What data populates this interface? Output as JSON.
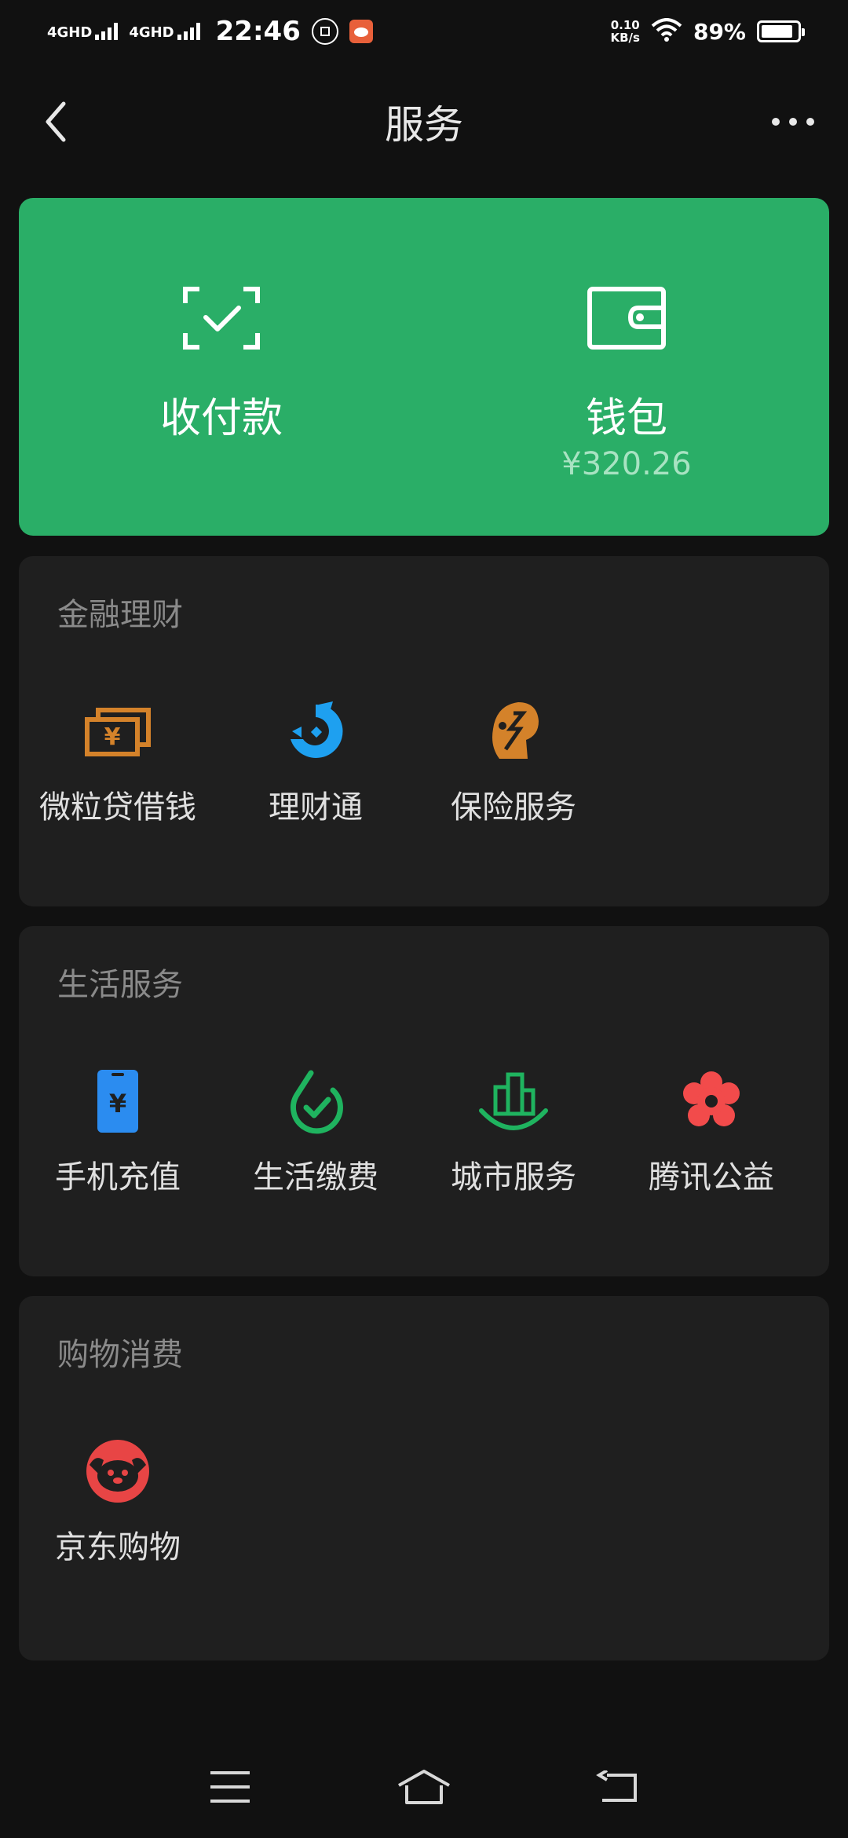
{
  "status_bar": {
    "net1": "4GHD",
    "net2": "4GHD",
    "time": "22:46",
    "speed_value": "0.10",
    "speed_unit": "KB/s",
    "battery": "89%",
    "battery_level": 0.89
  },
  "header": {
    "title": "服务"
  },
  "wallet_card": {
    "pay_label": "收付款",
    "wallet_label": "钱包",
    "wallet_balance": "¥320.26"
  },
  "sections": {
    "finance": {
      "title": "金融理财",
      "items": [
        {
          "label": "微粒贷借钱",
          "icon": "weilidai-icon"
        },
        {
          "label": "理财通",
          "icon": "licaitong-icon"
        },
        {
          "label": "保险服务",
          "icon": "insurance-icon"
        }
      ]
    },
    "life": {
      "title": "生活服务",
      "items": [
        {
          "label": "手机充值",
          "icon": "phone-topup-icon"
        },
        {
          "label": "生活缴费",
          "icon": "utility-payment-icon"
        },
        {
          "label": "城市服务",
          "icon": "city-services-icon"
        },
        {
          "label": "腾讯公益",
          "icon": "tencent-charity-icon"
        }
      ]
    },
    "shopping": {
      "title": "购物消费",
      "items": [
        {
          "label": "京东购物",
          "icon": "jd-shopping-icon"
        }
      ]
    }
  },
  "colors": {
    "accent_green": "#2aae67",
    "finance_orange": "#d4822a",
    "licaitong_blue": "#1ea0f0",
    "phone_blue": "#2b8cf0",
    "life_green": "#1fb35f",
    "charity_red": "#f24b4b",
    "jd_red": "#e84545"
  }
}
